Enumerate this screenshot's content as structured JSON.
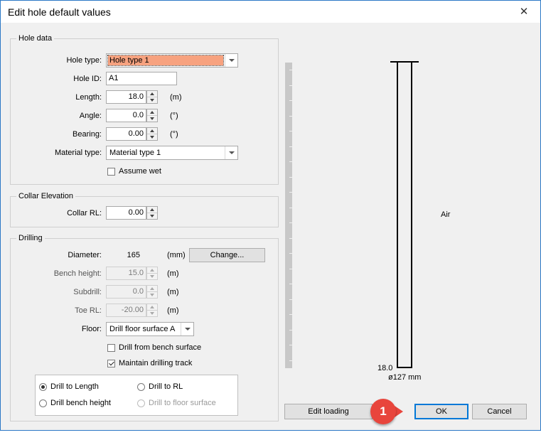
{
  "window": {
    "title": "Edit hole default values",
    "close_glyph": "✕"
  },
  "hole_data": {
    "group_label": "Hole data",
    "hole_type": {
      "label": "Hole type:",
      "value": "Hole type 1"
    },
    "hole_id": {
      "label": "Hole ID:",
      "value": "A1"
    },
    "length": {
      "label": "Length:",
      "value": "18.0",
      "unit": "(m)"
    },
    "angle": {
      "label": "Angle:",
      "value": "0.0",
      "unit": "(°)"
    },
    "bearing": {
      "label": "Bearing:",
      "value": "0.00",
      "unit": "(°)"
    },
    "material_type": {
      "label": "Material type:",
      "value": "Material type 1"
    },
    "assume_wet": {
      "label": "Assume wet",
      "checked": false
    }
  },
  "collar_elevation": {
    "group_label": "Collar Elevation",
    "collar_rl": {
      "label": "Collar RL:",
      "value": "0.00"
    }
  },
  "drilling": {
    "group_label": "Drilling",
    "diameter": {
      "label": "Diameter:",
      "value": "165",
      "unit": "(mm)",
      "change_label": "Change..."
    },
    "bench_height": {
      "label": "Bench height:",
      "value": "15.0",
      "unit": "(m)"
    },
    "subdrill": {
      "label": "Subdrill:",
      "value": "0.0",
      "unit": "(m)"
    },
    "toe_rl": {
      "label": "Toe RL:",
      "value": "-20.00",
      "unit": "(m)"
    },
    "floor": {
      "label": "Floor:",
      "value": "Drill floor surface A"
    },
    "drill_from_bench": {
      "label": "Drill from bench surface",
      "checked": false
    },
    "maintain_track": {
      "label": "Maintain drilling track",
      "checked": true
    },
    "mode": {
      "drill_to_length": "Drill to Length",
      "drill_to_rl": "Drill to RL",
      "drill_bench_height": "Drill bench height",
      "drill_to_floor": "Drill to floor surface",
      "selected": "drill_to_length"
    }
  },
  "preview": {
    "material_label": "Air",
    "depth_label": "18.0",
    "diameter_label": "ø127 mm"
  },
  "footer": {
    "edit_loading": "Edit loading",
    "ok": "OK",
    "cancel": "Cancel"
  },
  "marker": {
    "number": "1",
    "color": "#e8453c"
  },
  "colors": {
    "accent": "#0078d7",
    "highlight": "#f7a27f"
  }
}
